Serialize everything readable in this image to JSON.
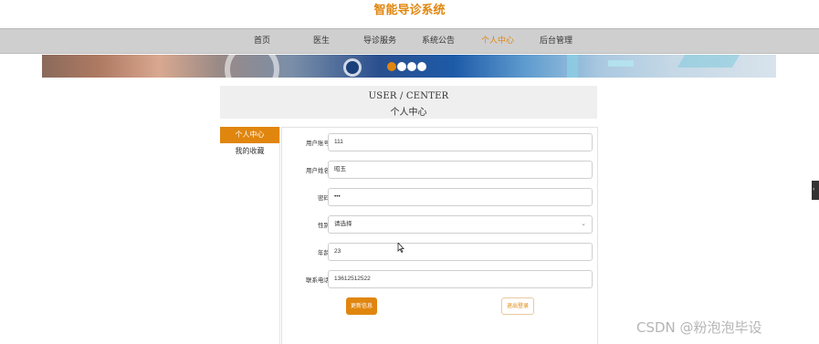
{
  "site": {
    "title": "智能导诊系统"
  },
  "nav": {
    "items": [
      {
        "label": "首页"
      },
      {
        "label": "医生"
      },
      {
        "label": "导诊服务"
      },
      {
        "label": "系统公告"
      },
      {
        "label": "个人中心"
      },
      {
        "label": "后台管理"
      }
    ],
    "active_index": 4
  },
  "banner": {
    "slide_count": 4,
    "active_slide": 1
  },
  "center": {
    "title_en": "USER / CENTER",
    "title_cn": "个人中心"
  },
  "sidebar": {
    "items": [
      {
        "label": "个人中心"
      },
      {
        "label": "我的收藏"
      }
    ]
  },
  "form": {
    "fields": [
      {
        "label": "用户账号",
        "value": "111"
      },
      {
        "label": "用户姓名",
        "value": "昭玉"
      },
      {
        "label": "密码",
        "value": "•••"
      },
      {
        "label": "性别",
        "value": "请选择"
      },
      {
        "label": "年龄",
        "value": "23"
      },
      {
        "label": "联系电话",
        "value": "13612512522"
      }
    ],
    "update_label": "更新信息",
    "logout_label": "退出登录"
  },
  "watermark": "CSDN @粉泡泡毕设",
  "colors": {
    "accent": "#e0860e",
    "nav_bg": "#cfcfcf"
  }
}
